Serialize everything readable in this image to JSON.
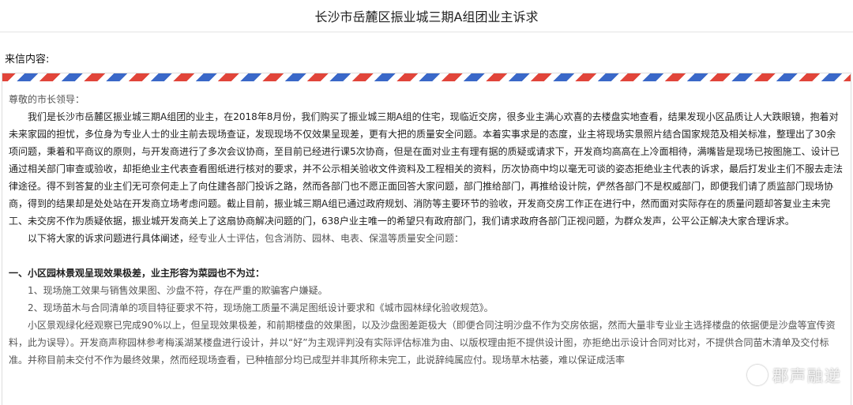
{
  "header": {
    "title": "长沙市岳麓区振业城三期A组团业主诉求"
  },
  "letter": {
    "label": "来信内容:",
    "greeting": "尊敬的市长领导：",
    "para1": "我们是长沙市岳麓区振业城三期A组团的业主，在2018年8月份，我们购买了振业城三期A组的住宅，现临近交房，很多业主满心欢喜的去楼盘实地查看，结果发现小区品质让人大跌眼镜，抱着对未来家园的担忧，多位身为专业人士的业主前去现场查证，发现现场不仅效果呈现差，更有大把的质量安全问题。本着实事求是的态度，业主将现场实景照片结合国家规范及相关标准，整理出了30余项问题，秉着和平商议的原则，与开发商进行了多次会议协商，至目前已经进行课5次协商，但是在面对业主有理有据的质疑或请求下，开发商均高高在上冷面相待，满嘴皆是现场已按图施工、设计已通过相关部门审查或验收，却拒绝业主代表查看图纸进行核对的要求，并不公示相关验收文件资料及工程相关的资料，历次协商中均以毫无可谈的姿态拒绝业主代表的诉求，最后打发业主们不服去走法律途径。得不到答复的业主们无可奈何走上了向住建各部门投诉之路，然而各部门也不愿正面回答大家问题，部门推给部门，再推给设计院，俨然各部门不是权威部门，即便我们请了质监部门现场协商，得到的结果却是处处站在开发商立场考虑问题。截止目前，振业城三期A组已通过政府规划、消防等主要环节的验收，开发商交房工作正在进行中，然而面对实际存在的质量问题却答复业主未完工、未交房不作为质疑依据，振业城开发商关上了这扇协商解决问题的门，638户业主唯一的希望只有政府部门，我们请求政府各部门正视问题，为群众发声，公平公正解决大家合理诉求。",
    "para2_main": "以下将大家的诉求问题进行具体阐述，",
    "para2_note": "经专业人士评估，包含消防、园林、电表、保温等质量安全问题：",
    "heading1": "一、小区园林景观呈现效果极差，业主形容为菜园也不为过：",
    "item1": "1、现场施工效果与销售效果图、沙盘不符，存在严重的欺骗客户嫌疑。",
    "item2": "2、现场苗木与合同清单的项目特征要求不符，现场施工质量不满足图纸设计要求和《城市园林绿化验收规范》。",
    "para3": "小区景观绿化经观察已完成90%以上，但呈现效果极差，和前期楼盘的效果图，以及沙盘图差距极大（即便合同注明沙盘不作为交房依据，然而大量非专业业主选择楼盘的依据便是沙盘等宣传资料，此为误导）。开发商声称园林参考梅溪湖某楼盘进行设计，并以“好”为主观评判没有实际评估标准为由、以版权理由拒不提供设计图，亦拒绝出示设计合同对比对，不提供合同苗木清单及交付标准。并称目前未交付不作为最终效果，然而经现场查看，已种植部分均已成型并非其所称未完工，此说辞纯属应付。现场草木枯萎，难以保证成活率"
  },
  "watermark": {
    "text": "郡声融逆"
  }
}
